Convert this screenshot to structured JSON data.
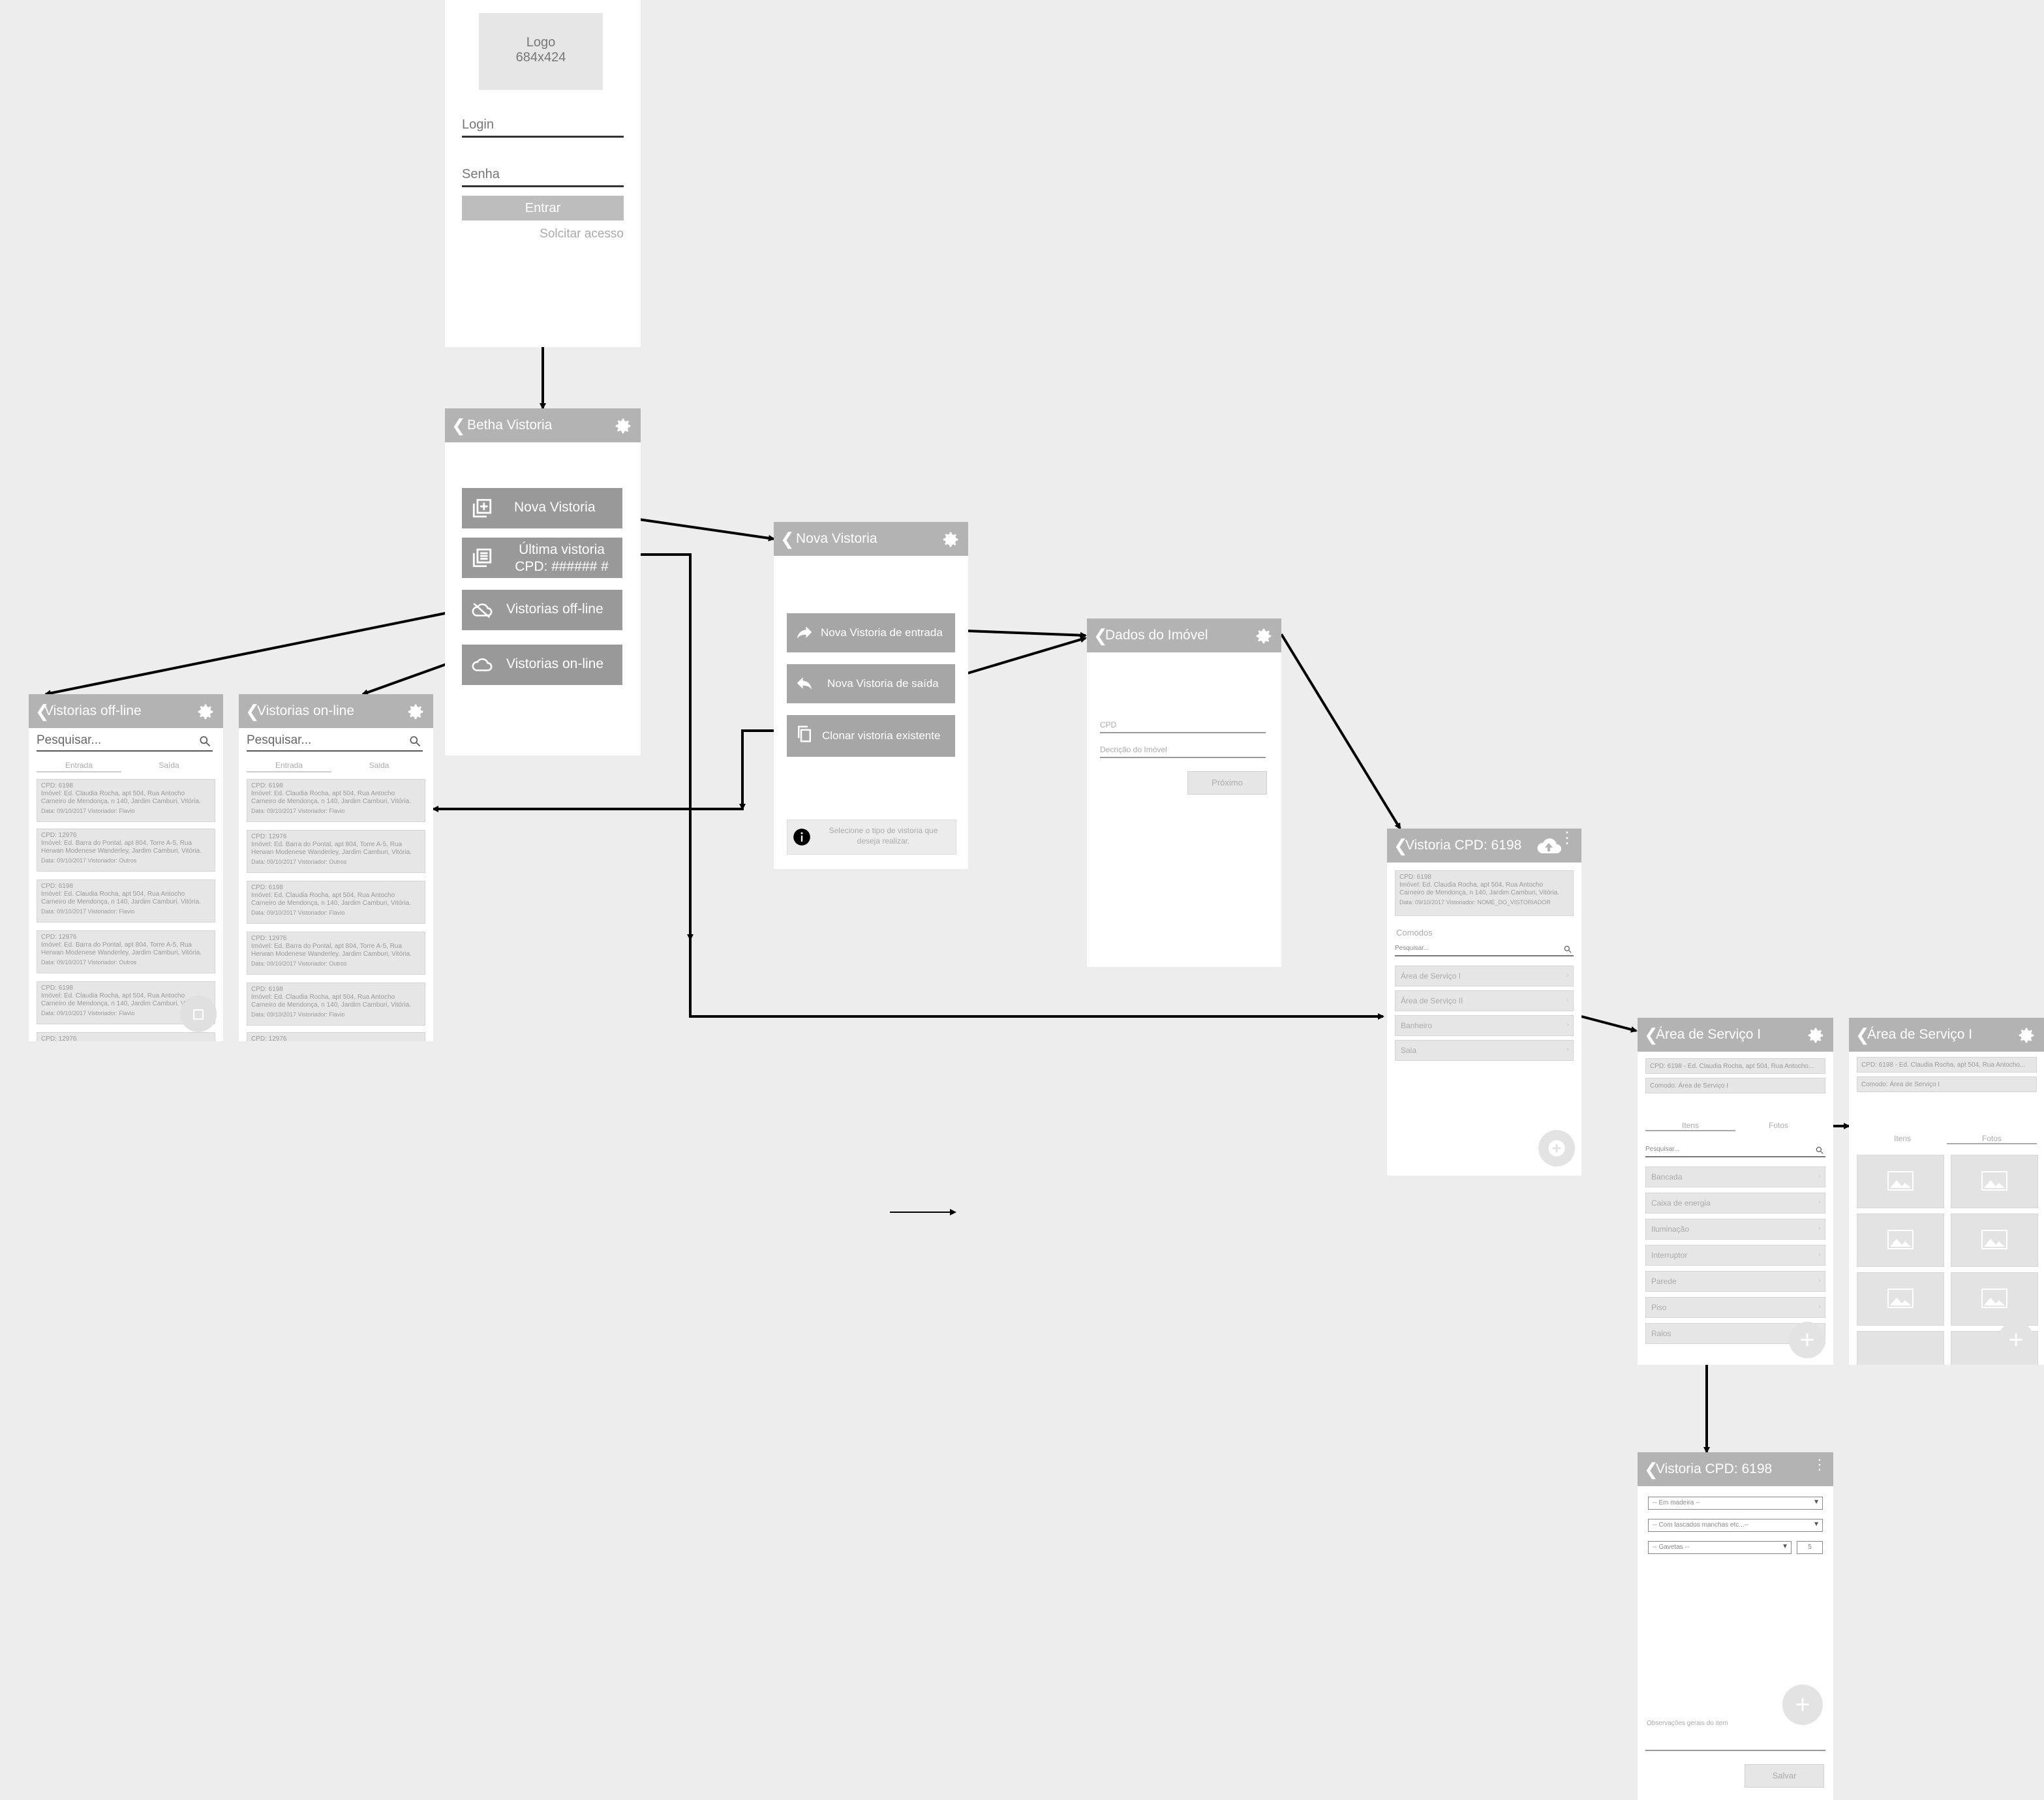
{
  "login": {
    "logo_line1": "Logo",
    "logo_line2": "684x424",
    "login_label": "Login",
    "senha_label": "Senha",
    "entrar_label": "Entrar",
    "solicitar_label": "Solcitar acesso"
  },
  "home": {
    "title": "Betha Vistoria",
    "nova_label": "Nova Vistoria",
    "ultima_line1": "Última vistoria",
    "ultima_line2": "CPD: ###### #",
    "offline_label": "Vistorias off-line",
    "online_label": "Vistorias on-line"
  },
  "offline": {
    "title": "Vistorias off-line",
    "search_placeholder": "Pesquisar...",
    "tab_entrada": "Entrada",
    "tab_saida": "Saída",
    "items": [
      {
        "cpd": "CPD: 6198",
        "imovel": "Imóvel: Ed. Claudia Rocha, apt 504, Rua Antocho Carneiro de Mendonça, n 140, Jardim Camburi, Vitória.",
        "meta": "Data: 09/10/2017     Vistoriador: Flavio"
      },
      {
        "cpd": "CPD: 12976",
        "imovel": "Imóvel: Ed. Barra do Pontal, apt 804, Torre A-5, Rua Herwan Modenese Wanderley, Jardim Camburi, Vitória.",
        "meta": "Data: 09/10/2017     Vistoriador: Outros"
      },
      {
        "cpd": "CPD: 6198",
        "imovel": "Imóvel: Ed. Claudia Rocha, apt 504, Rua Antocho Carneiro de Mendonça, n 140, Jardim Camburi, Vitória.",
        "meta": "Data: 09/10/2017     Vistoriador: Flavio"
      },
      {
        "cpd": "CPD: 12976",
        "imovel": "Imóvel: Ed. Barra do Pontal, apt 804, Torre A-5, Rua Herwan Modenese Wanderley, Jardim Camburi, Vitória.",
        "meta": "Data: 09/10/2017     Vistoriador: Outros"
      },
      {
        "cpd": "CPD: 6198",
        "imovel": "Imóvel: Ed. Claudia Rocha, apt 504, Rua Antocho Carneiro de Mendonça, n 140, Jardim Camburi, Vitória.",
        "meta": "Data: 09/10/2017     Vistoriador: Flavio"
      }
    ],
    "last_cpd": "CPD: 12976"
  },
  "online": {
    "title": "Vistorias on-line",
    "search_placeholder": "Pesquisar...",
    "tab_entrada": "Entrada",
    "tab_saida": "Saida",
    "items": [
      {
        "cpd": "CPD: 6198",
        "imovel": "Imóvel: Ed. Claudia Rocha, apt 504, Rua Antocho Carneiro de Mendonça, n 140, Jardim Camburi, Vitória.",
        "meta": "Data: 09/10/2017     Vistoriador: Flavio"
      },
      {
        "cpd": "CPD: 12976",
        "imovel": "Imóvel: Ed. Barra do Pontal, apt 804, Torre A-5, Rua Herwan Modenese Wanderley, Jardim Camburi, Vitória.",
        "meta": "Data: 09/10/2017     Vistoriador: Outros"
      },
      {
        "cpd": "CPD: 6198",
        "imovel": "Imóvel: Ed. Claudia Rocha, apt 504, Rua Antocho Carneiro de Mendonça, n 140, Jardim Camburi, Vitória.",
        "meta": "Data: 09/10/2017     Vistoriador: Flavio"
      },
      {
        "cpd": "CPD: 12976",
        "imovel": "Imóvel: Ed. Barra do Pontal, apt 804, Torre A-5, Rua Herwan Modenese Wanderley, Jardim Camburi, Vitória.",
        "meta": "Data: 09/10/2017     Vistoriador: Outros"
      },
      {
        "cpd": "CPD: 6198",
        "imovel": "Imóvel: Ed. Claudia Rocha, apt 504, Rua Antocho Carneiro de Mendonça, n 140, Jardim Camburi, Vitória.",
        "meta": "Data: 09/10/2017     Vistoriador: Flavio"
      }
    ],
    "last_cpd": "CPD: 12976"
  },
  "nova": {
    "title": "Nova Vistoria",
    "entrada_label": "Nova Vistoria de entrada",
    "saida_label": "Nova Vistoria de saída",
    "clonar_label": "Clonar vistoria existente",
    "info_line1": "Selecione o tipo de vistoria que",
    "info_line2": "deseja realizar."
  },
  "dados": {
    "title": "Dados do Imóvel",
    "cpd_label": "CPD",
    "descricao_label": "Decrição do Imóvel",
    "proximo_label": "Próximo"
  },
  "vistoria": {
    "title": "Vistoria CPD: 6198",
    "card_cpd": "CPD: 6198",
    "card_imovel": "Imóvel: Ed. Claudia Rocha, apt 504, Rua Antocho Carneiro de Mendonça, n 140, Jardim Camburi, Vitória.",
    "card_meta": "Data: 09/10/2017     Vistoriador: NOME_DO_VISTORIADOR",
    "comodos_label": "Comodos",
    "search_placeholder": "Pesquisar...",
    "comodos": [
      "Área de Serviço I",
      "Área de Serviço II",
      "Banheiro",
      "Sala"
    ]
  },
  "area1": {
    "title": "Área de Serviço I",
    "cpd_field": "CPD: 6198 - Ed. Claudia Rocha, apt 504, Rua Antocho...",
    "comodo_field": "Comodo: Área de Serviço I",
    "tab_itens": "Itens",
    "tab_fotos": "Fotos",
    "search_placeholder": "Pesquisar...",
    "items": [
      "Bancada",
      "Caixa de energia",
      "Iluminação",
      "Interruptor",
      "Parede",
      "Piso",
      "Ralos"
    ]
  },
  "area2": {
    "title": "Área de Serviço I",
    "cpd_field": "CPD: 6198 - Ed. Claudia Rocha, apt 504, Rua Antocho...",
    "comodo_field": "Comodo: Área de Serviço I",
    "tab_itens": "Itens",
    "tab_fotos": "Fotos"
  },
  "item": {
    "title": "Vistoria CPD: 6198",
    "select1": "-- Em madeira --",
    "select2": "-- Com lascados manchas etc...--",
    "select3": "-- Gavetas --",
    "qty": "5",
    "obs_label": "Observações gerais do item",
    "salvar_label": "Salvar"
  }
}
